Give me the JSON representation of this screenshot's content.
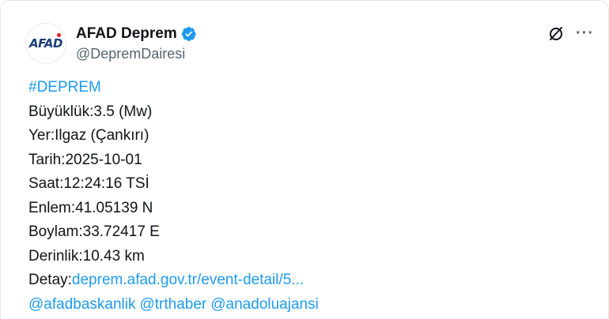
{
  "account": {
    "display_name": "AFAD Deprem",
    "handle": "@DepremDairesi",
    "avatar_text": "AFAD"
  },
  "post": {
    "hashtag": "#DEPREM",
    "lines": [
      "Büyüklük:3.5 (Mw)",
      "Yer:Ilgaz (Çankırı)",
      "Tarih:2025-10-01",
      "Saat:12:24:16 TSİ",
      "Enlem:41.05139 N",
      "Boylam:33.72417 E",
      "Derinlik:10.43 km"
    ],
    "detail_label": "Detay:",
    "detail_link": "deprem.afad.gov.tr/event-detail/5...",
    "mentions": [
      "@afadbaskanlik",
      "@trthaber",
      "@anadoluajansi"
    ]
  },
  "icons": {
    "verified": "verified-badge-icon",
    "grok": "grok-icon",
    "more": "more-options-icon"
  },
  "colors": {
    "link": "#1d9bf0",
    "text": "#0f1419",
    "secondary": "#536471",
    "brand": "#1c3f7a",
    "brand_accent": "#e2231a"
  },
  "more_glyph": "···"
}
